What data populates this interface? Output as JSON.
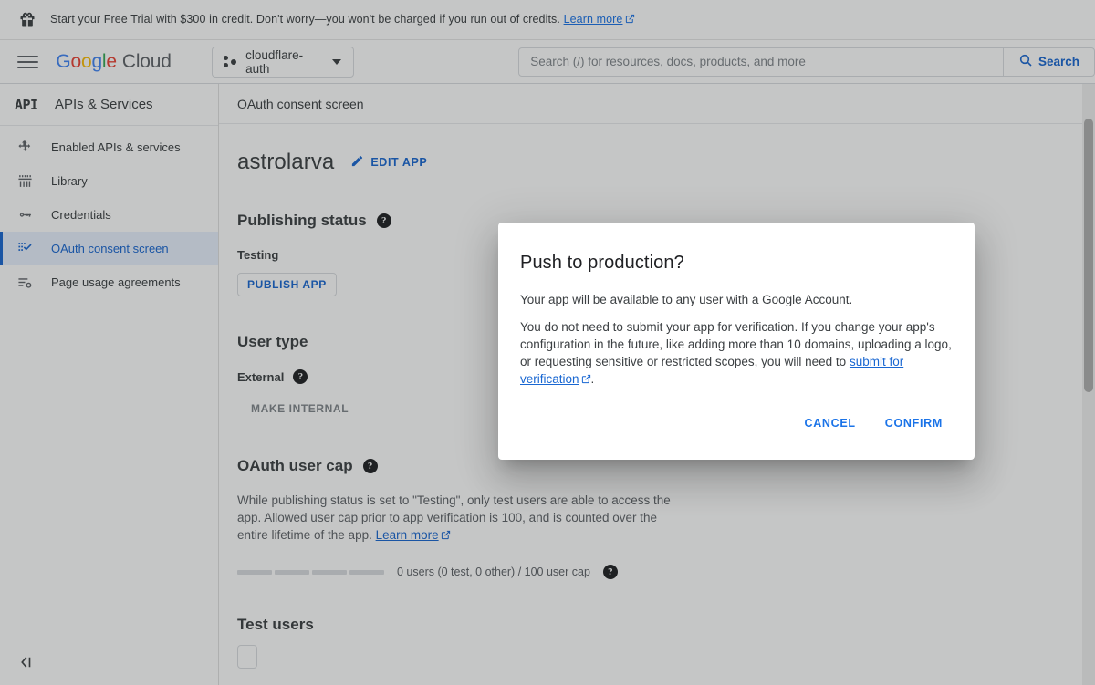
{
  "banner": {
    "icon": "gift-icon",
    "text": "Start your Free Trial with $300 in credit. Don't worry—you won't be charged if you run out of credits.",
    "link_label": "Learn more"
  },
  "header": {
    "menu_icon": "hamburger-menu-icon",
    "brand": {
      "g1": "G",
      "g2": "o",
      "g3": "o",
      "g4": "g",
      "g5": "l",
      "g6": "e",
      "cloud": "Cloud"
    },
    "project": {
      "name": "cloudflare-auth",
      "icon": "project-dots-icon",
      "caret_icon": "chevron-down-icon"
    },
    "search": {
      "placeholder": "Search (/) for resources, docs, products, and more",
      "value": "",
      "button_label": "Search",
      "button_icon": "search-icon"
    }
  },
  "sidebar": {
    "logo_text": "API",
    "title": "APIs & Services",
    "items": [
      {
        "label": "Enabled APIs & services",
        "icon": "enabled-apis-icon",
        "active": false
      },
      {
        "label": "Library",
        "icon": "library-icon",
        "active": false
      },
      {
        "label": "Credentials",
        "icon": "key-icon",
        "active": false
      },
      {
        "label": "OAuth consent screen",
        "icon": "consent-checklist-icon",
        "active": true
      },
      {
        "label": "Page usage agreements",
        "icon": "page-agreements-icon",
        "active": false
      }
    ],
    "collapse_label": "Collapse sidebar",
    "collapse_icon": "collapse-left-icon"
  },
  "content": {
    "breadcrumb": "OAuth consent screen",
    "app_name": "astrolarva",
    "edit_app_label": "EDIT APP",
    "edit_app_icon": "pencil-icon",
    "publishing": {
      "heading": "Publishing status",
      "help_icon": "help-icon",
      "status": "Testing",
      "publish_button": "PUBLISH APP"
    },
    "user_type": {
      "heading": "User type",
      "value": "External",
      "help_icon": "help-icon",
      "make_internal_button": "MAKE INTERNAL"
    },
    "user_cap": {
      "heading": "OAuth user cap",
      "help_icon": "help-icon",
      "description_part1": "While publishing status is set to \"Testing\", only test users are able to access the app. Allowed user cap prior to app verification is 100, and is counted over the entire lifetime of the app. ",
      "learn_more": "Learn more",
      "progress_segments": 4,
      "progress_text": "0 users (0 test, 0 other) / 100 user cap"
    },
    "test_users": {
      "heading": "Test users"
    }
  },
  "dialog": {
    "title": "Push to production?",
    "paragraph1": "Your app will be available to any user with a Google Account.",
    "paragraph2_part1": "You do not need to submit your app for verification. If you change your app's configuration in the future, like adding more than 10 domains, uploading a logo, or requesting sensitive or restricted scopes, you will need to ",
    "paragraph2_link": "submit for verification",
    "paragraph2_part2": ".",
    "cancel_label": "CANCEL",
    "confirm_label": "CONFIRM"
  },
  "colors": {
    "accent_blue": "#1a73e8",
    "link_blue": "#1967d2",
    "active_bg": "#e8f0fe",
    "text_primary": "#3c4043",
    "text_secondary": "#5f6368"
  },
  "scrollbar": {
    "name": "vertical-scrollbar"
  }
}
